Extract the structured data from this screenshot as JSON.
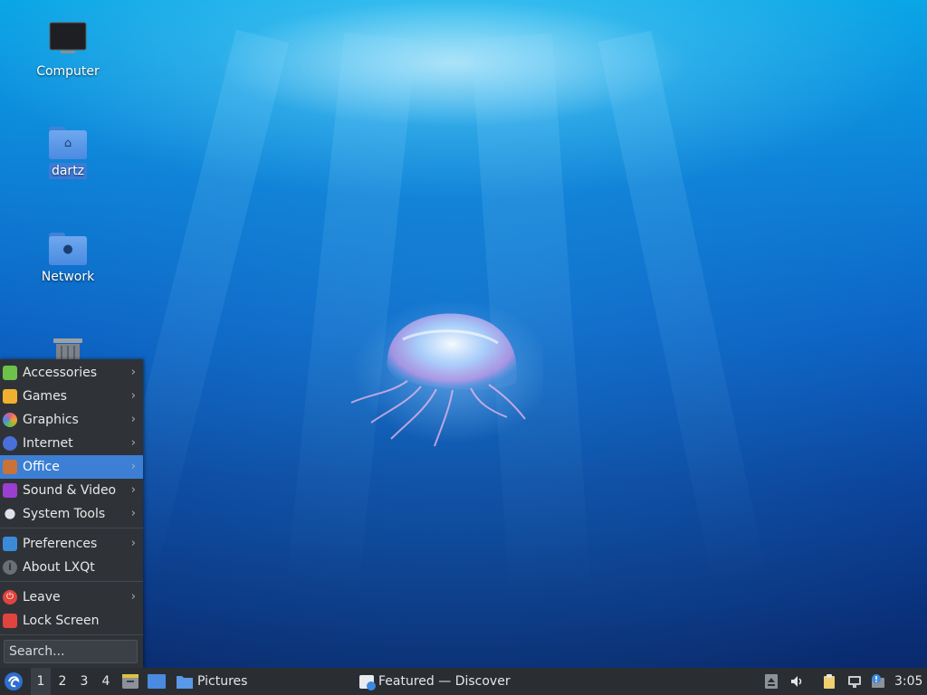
{
  "desktop": {
    "icons": [
      {
        "name": "computer",
        "label": "Computer"
      },
      {
        "name": "home-folder",
        "label": "dartz"
      },
      {
        "name": "network",
        "label": "Network"
      },
      {
        "name": "trash",
        "label": ""
      }
    ]
  },
  "menu": {
    "categories": [
      {
        "label": "Accessories",
        "icon": "accessories-icon",
        "color": "#6cc24a"
      },
      {
        "label": "Games",
        "icon": "games-icon",
        "color": "#f0b030"
      },
      {
        "label": "Graphics",
        "icon": "graphics-icon",
        "color": "#e05a8a"
      },
      {
        "label": "Internet",
        "icon": "internet-icon",
        "color": "#4a6fd8"
      },
      {
        "label": "Office",
        "icon": "office-icon",
        "color": "#c9723a"
      },
      {
        "label": "Sound & Video",
        "icon": "sound-video-icon",
        "color": "#9b3fd0"
      },
      {
        "label": "System Tools",
        "icon": "system-tools-icon",
        "color": "#dfe3e8"
      }
    ],
    "preferences": {
      "label": "Preferences"
    },
    "about": {
      "label": "About LXQt"
    },
    "leave": {
      "label": "Leave"
    },
    "lock": {
      "label": "Lock Screen"
    },
    "search_placeholder": "Search...",
    "active_item": "Office"
  },
  "taskbar": {
    "workspaces": [
      "1",
      "2",
      "3",
      "4"
    ],
    "current_workspace": "1",
    "tasks": [
      {
        "label": "Pictures",
        "icon": "folder-icon"
      },
      {
        "label": "Featured — Discover",
        "icon": "discover-icon"
      }
    ],
    "clock": "3:05"
  },
  "colors": {
    "panel_bg": "#2a2e33",
    "menu_bg": "#2f3338",
    "highlight": "#3c7fd4"
  }
}
